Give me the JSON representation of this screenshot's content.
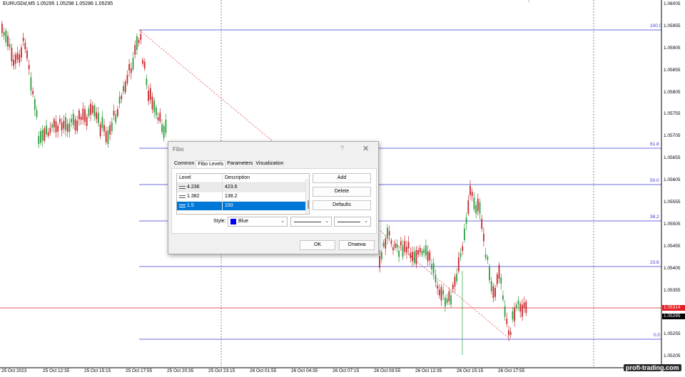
{
  "chart": {
    "symbol_info": "EURUSDd,M5  1.05295 1.05298 1.05286 1.05295",
    "price_axis": [
      "1.06005",
      "1.05955",
      "1.05905",
      "1.05855",
      "1.05805",
      "1.05755",
      "1.05705",
      "1.05655",
      "1.05605",
      "1.05555",
      "1.05505",
      "1.05455",
      "1.05405",
      "1.05355",
      "1.05255",
      "1.05205"
    ],
    "time_axis": [
      "25 Oct 2023",
      "25 Oct 12:35",
      "25 Oct 15:15",
      "25 Oct 17:55",
      "25 Oct 20:35",
      "25 Oct 23:15",
      "26 Oct 01:55",
      "26 Oct 04:35",
      "26 Oct 07:15",
      "26 Oct 09:55",
      "26 Oct 12:35",
      "26 Oct 15:15",
      "26 Oct 17:55"
    ],
    "fib_levels": [
      "100.0",
      "61.8",
      "50.0",
      "38.2",
      "23.6",
      "0.0"
    ],
    "bid_price": "1.05314",
    "current_price": "1.05295",
    "bid_line_color": "#e51c23",
    "fib_line_color": "#3b3bd6",
    "bull_color": "#2e9e3e",
    "bear_color": "#c8282d"
  },
  "watermark": "profi-trading.com",
  "dialog": {
    "title": "Fibo",
    "help": "?",
    "close_icon": "close-icon",
    "tabs": [
      "Common",
      "Fibo Levels",
      "Parameters",
      "Visualization"
    ],
    "active_tab": "Fibo Levels",
    "table": {
      "headers": [
        "Level",
        "Description"
      ],
      "rows": [
        {
          "level": "4.236",
          "description": "423.6"
        },
        {
          "level": "1.382",
          "description": "138.2"
        },
        {
          "level": "1.5",
          "description": "150"
        }
      ],
      "selected_index": 2
    },
    "buttons": {
      "add": "Add",
      "delete": "Delete",
      "defaults": "Defaults",
      "ok": "OK",
      "cancel": "Отмена"
    },
    "style_label": "Style:",
    "style_color_value": "Blue",
    "style_color_hex": "#0000ff"
  }
}
